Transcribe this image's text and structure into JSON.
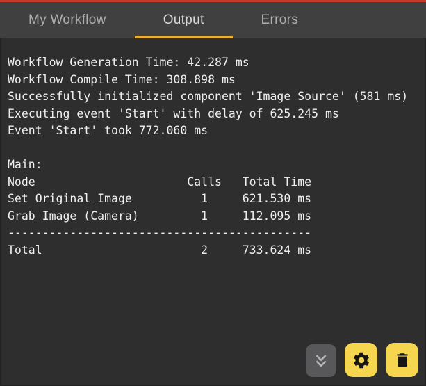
{
  "tabs": [
    {
      "label": "My Workflow",
      "active": false
    },
    {
      "label": "Output",
      "active": true
    },
    {
      "label": "Errors",
      "active": false
    }
  ],
  "console": {
    "lines": [
      "Workflow Generation Time: 42.287 ms",
      "Workflow Compile Time: 308.898 ms",
      "Successfully initialized component 'Image Source' (581 ms)",
      "Executing event 'Start' with delay of 625.245 ms",
      "Event 'Start' took 772.060 ms",
      "",
      "Main:",
      "Node                      Calls   Total Time",
      "Set Original Image          1     621.530 ms",
      "Grab Image (Camera)         1     112.095 ms",
      "--------------------------------------------",
      "Total                       2     733.624 ms"
    ],
    "profile": {
      "section": "Main:",
      "columns": [
        "Node",
        "Calls",
        "Total Time"
      ],
      "rows": [
        {
          "node": "Set Original Image",
          "calls": "1",
          "total_time": "621.530 ms"
        },
        {
          "node": "Grab Image (Camera)",
          "calls": "1",
          "total_time": "112.095 ms"
        }
      ],
      "total_row": {
        "node": "Total",
        "calls": "2",
        "total_time": "733.624 ms"
      },
      "timings": {
        "workflow_generation_ms": "42.287",
        "workflow_compile_ms": "308.898",
        "image_source_init_ms": "581",
        "start_event_delay_ms": "625.245",
        "start_event_took_ms": "772.060"
      }
    }
  },
  "actions": {
    "scroll_down": {
      "icon": "double-chevron-down-icon"
    },
    "settings": {
      "icon": "gear-icon"
    },
    "delete": {
      "icon": "trash-icon"
    }
  },
  "colors": {
    "top_edge_red": "#c5392b",
    "active_tab_underline_gold": "#e9b02d",
    "action_button_yellow": "#f6d54f",
    "tabbar_bg": "#404040",
    "console_bg": "#2e2e2e",
    "console_text": "#efefef",
    "scroll_button_gray": "#58585a"
  }
}
